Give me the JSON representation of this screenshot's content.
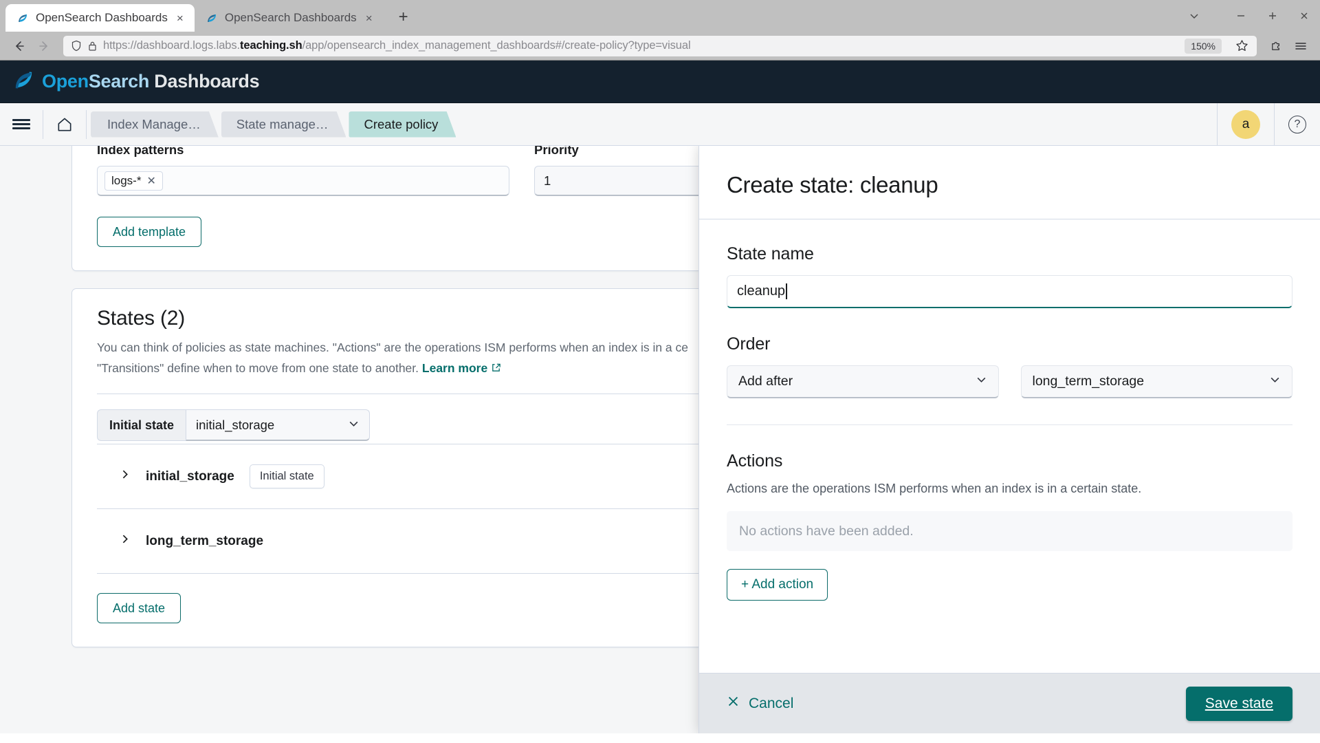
{
  "browser": {
    "tabs": [
      {
        "title": "OpenSearch Dashboards",
        "active": true,
        "favicon": "opensearch-favicon",
        "close": "×"
      },
      {
        "title": "OpenSearch Dashboards",
        "active": false,
        "favicon": "opensearch-favicon",
        "close": "×"
      }
    ],
    "new_tab_label": "+",
    "window_controls": {
      "tab_list": "⌄",
      "minimize": "−",
      "maximize": "+",
      "close": "✕"
    },
    "nav": {
      "back": "←",
      "forward": "→"
    },
    "url": {
      "prefix": "https://dashboard.logs.labs.",
      "domain": "teaching.sh",
      "path": "/app/opensearch_index_management_dashboards#/create-policy?type=visual"
    },
    "zoom_level": "150%",
    "toolbar_icons": [
      "bookmark-star-icon",
      "extensions-puzzle-icon",
      "browser-menu-icon"
    ]
  },
  "app_header": {
    "logo_open": "Open",
    "logo_search": "Search",
    "logo_dashboards": " Dashboards"
  },
  "nav_bar": {
    "breadcrumbs": [
      {
        "label": "Index Manage…",
        "active": false
      },
      {
        "label": "State manage…",
        "active": false
      },
      {
        "label": "Create policy",
        "active": true
      }
    ],
    "avatar_initial": "a",
    "help_icon_label": "?"
  },
  "main": {
    "template_panel": {
      "index_patterns_label": "Index patterns",
      "index_pattern_pill": "logs-*",
      "pill_remove": "✕",
      "priority_label": "Priority",
      "priority_value": "1",
      "add_template_label": "Add template"
    },
    "states_panel": {
      "title": "States (2)",
      "description_line1": "You can think of policies as state machines. \"Actions\" are the operations ISM performs when an index is in a ce",
      "description_line2": "\"Transitions\" define when to move from one state to another.",
      "learn_more": "Learn more",
      "initial_state_label": "Initial state",
      "initial_state_value": "initial_storage",
      "rows": [
        {
          "name": "initial_storage",
          "badge": "Initial state"
        },
        {
          "name": "long_term_storage",
          "badge": ""
        }
      ],
      "add_state_label": "Add state"
    }
  },
  "flyout": {
    "title": "Create state: cleanup",
    "state_name_label": "State name",
    "state_name_value": "cleanup",
    "order_label": "Order",
    "order_position_value": "Add after",
    "order_target_value": "long_term_storage",
    "actions_label": "Actions",
    "actions_description": "Actions are the operations ISM performs when an index is in a certain state.",
    "actions_empty": "No actions have been added.",
    "add_action_label": "+ Add action",
    "cancel_label": "Cancel",
    "cancel_icon": "✕",
    "save_label": "Save state"
  },
  "colors": {
    "brand_dark": "#14212e",
    "accent_teal": "#056e6b",
    "breadcrumb_active": "#b9dfdb",
    "avatar_yellow": "#f2d675"
  }
}
